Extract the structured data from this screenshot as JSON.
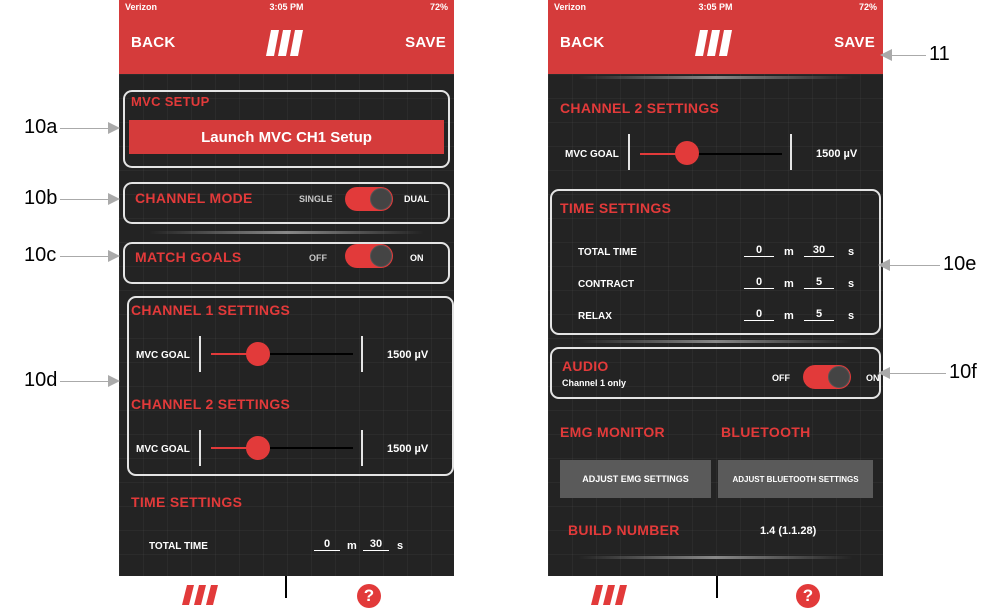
{
  "status": {
    "carrier": "Verizon",
    "time": "3:05 PM",
    "battery": "72%"
  },
  "nav": {
    "back": "BACK",
    "save": "SAVE"
  },
  "left": {
    "mvc_setup_title": "MVC SETUP",
    "launch_button": "Launch MVC CH1 Setup",
    "channel_mode": {
      "label": "CHANNEL MODE",
      "off": "SINGLE",
      "on": "DUAL"
    },
    "match_goals": {
      "label": "MATCH GOALS",
      "off": "OFF",
      "on": "ON"
    },
    "ch1": {
      "title": "CHANNEL 1 SETTINGS",
      "goal_label": "MVC GOAL",
      "value": "1500",
      "unit": "µV"
    },
    "ch2": {
      "title": "CHANNEL 2 SETTINGS",
      "goal_label": "MVC GOAL",
      "value": "1500",
      "unit": "µV"
    },
    "time_title": "TIME SETTINGS",
    "total_time": {
      "label": "TOTAL TIME",
      "m": "0",
      "s": "30"
    }
  },
  "right": {
    "ch2": {
      "title": "CHANNEL 2 SETTINGS",
      "goal_label": "MVC GOAL",
      "value": "1500",
      "unit": "µV"
    },
    "time_title": "TIME SETTINGS",
    "rows": [
      {
        "label": "TOTAL TIME",
        "m": "0",
        "s": "30"
      },
      {
        "label": "CONTRACT",
        "m": "0",
        "s": "5"
      },
      {
        "label": "RELAX",
        "m": "0",
        "s": "5"
      }
    ],
    "audio": {
      "label": "AUDIO",
      "sub": "Channel 1 only",
      "off": "OFF",
      "on": "ON"
    },
    "emg_title": "EMG MONITOR",
    "bt_title": "BLUETOOTH",
    "emg_button": "ADJUST EMG SETTINGS",
    "bt_button": "ADJUST BLUETOOTH SETTINGS",
    "build_label": "BUILD NUMBER",
    "build_value": "1.4 (1.1.28)"
  },
  "units": {
    "m": "m",
    "s": "s"
  },
  "callouts": {
    "a": "10a",
    "b": "10b",
    "c": "10c",
    "d": "10d",
    "e": "10e",
    "f": "10f",
    "save": "11"
  },
  "colors": {
    "accent": "#d53b3b",
    "background": "#232323"
  }
}
